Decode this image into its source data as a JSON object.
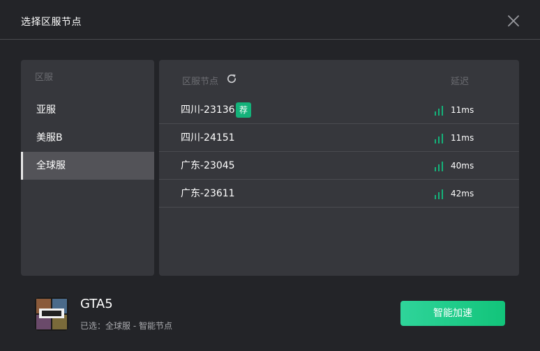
{
  "dialog": {
    "title": "选择区服节点"
  },
  "regions": {
    "header": "区服",
    "items": [
      {
        "label": "亚服"
      },
      {
        "label": "美服B"
      },
      {
        "label": "全球服",
        "active": true
      }
    ]
  },
  "nodes": {
    "header_label": "区服节点",
    "header_latency": "延迟",
    "items": [
      {
        "name": "四川-23136",
        "badge": "荐",
        "latency": "11ms"
      },
      {
        "name": "四川-24151",
        "latency": "11ms"
      },
      {
        "name": "广东-23045",
        "latency": "40ms"
      },
      {
        "name": "广东-23611",
        "latency": "42ms"
      }
    ]
  },
  "footer": {
    "game_name": "GTA5",
    "selected": "已选：全球服 - 智能节点",
    "accelerate_label": "智能加速"
  },
  "colors": {
    "accent": "#14b27a",
    "signal": "#14b27a",
    "background": "#232428",
    "panel": "#36373c"
  },
  "icons": {
    "close": "close-icon",
    "refresh": "refresh-icon",
    "signal": "signal-icon",
    "game": "gta5-game-icon"
  }
}
